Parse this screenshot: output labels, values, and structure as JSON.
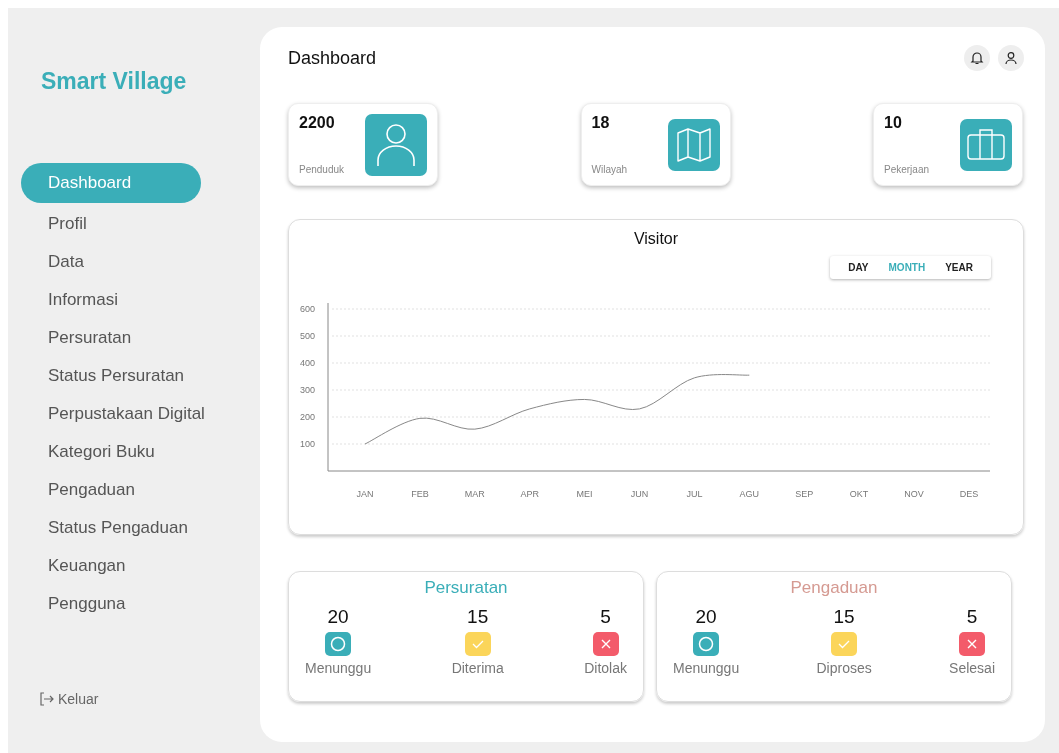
{
  "brand": "Smart Village",
  "sidebar": {
    "items": [
      {
        "label": "Dashboard",
        "selected": true
      },
      {
        "label": "Profil",
        "selected": false
      },
      {
        "label": "Data",
        "selected": false
      },
      {
        "label": "Informasi",
        "selected": false
      },
      {
        "label": "Persuratan",
        "selected": false
      },
      {
        "label": "Status Persuratan",
        "selected": false
      },
      {
        "label": "Perpustakaan Digital",
        "selected": false
      },
      {
        "label": "Kategori Buku",
        "selected": false
      },
      {
        "label": "Pengaduan",
        "selected": false
      },
      {
        "label": "Status Pengaduan",
        "selected": false
      },
      {
        "label": "Keuangan",
        "selected": false
      },
      {
        "label": "Pengguna",
        "selected": false
      }
    ],
    "logout": "Keluar"
  },
  "page_title": "Dashboard",
  "stats": [
    {
      "value": "2200",
      "label": "Penduduk",
      "kind": "person"
    },
    {
      "value": "18",
      "label": "Wilayah",
      "kind": "map"
    },
    {
      "value": "10",
      "label": "Pekerjaan",
      "kind": "briefcase"
    }
  ],
  "visitor": {
    "title": "Visitor",
    "ranges": [
      {
        "label": "DAY",
        "selected": false
      },
      {
        "label": "MONTH",
        "selected": true
      },
      {
        "label": "YEAR",
        "selected": false
      }
    ],
    "chart_data": {
      "type": "line",
      "categories": [
        "JAN",
        "FEB",
        "MAR",
        "APR",
        "MEI",
        "JUN",
        "JUL",
        "AGU",
        "SEP",
        "OKT",
        "NOV",
        "DES"
      ],
      "series": [
        {
          "color": "#888888",
          "values": [
            100,
            195,
            155,
            230,
            265,
            230,
            345,
            355,
            null,
            null,
            null,
            null
          ]
        }
      ],
      "grid": true,
      "ylim": [
        0,
        600
      ],
      "yticks": [
        100,
        200,
        300,
        400,
        500,
        600
      ]
    }
  },
  "panels": [
    {
      "title": "Persuratan",
      "color": "#3aaeb8",
      "items": [
        {
          "count": "20",
          "label": "Menunggu",
          "kind": "circle"
        },
        {
          "count": "15",
          "label": "Diterima",
          "kind": "check"
        },
        {
          "count": "5",
          "label": "Ditolak",
          "kind": "cross"
        }
      ]
    },
    {
      "title": "Pengaduan",
      "color": "#d59a92",
      "items": [
        {
          "count": "20",
          "label": "Menunggu",
          "kind": "circle"
        },
        {
          "count": "15",
          "label": "Diproses",
          "kind": "check"
        },
        {
          "count": "5",
          "label": "Selesai",
          "kind": "cross"
        }
      ]
    }
  ]
}
